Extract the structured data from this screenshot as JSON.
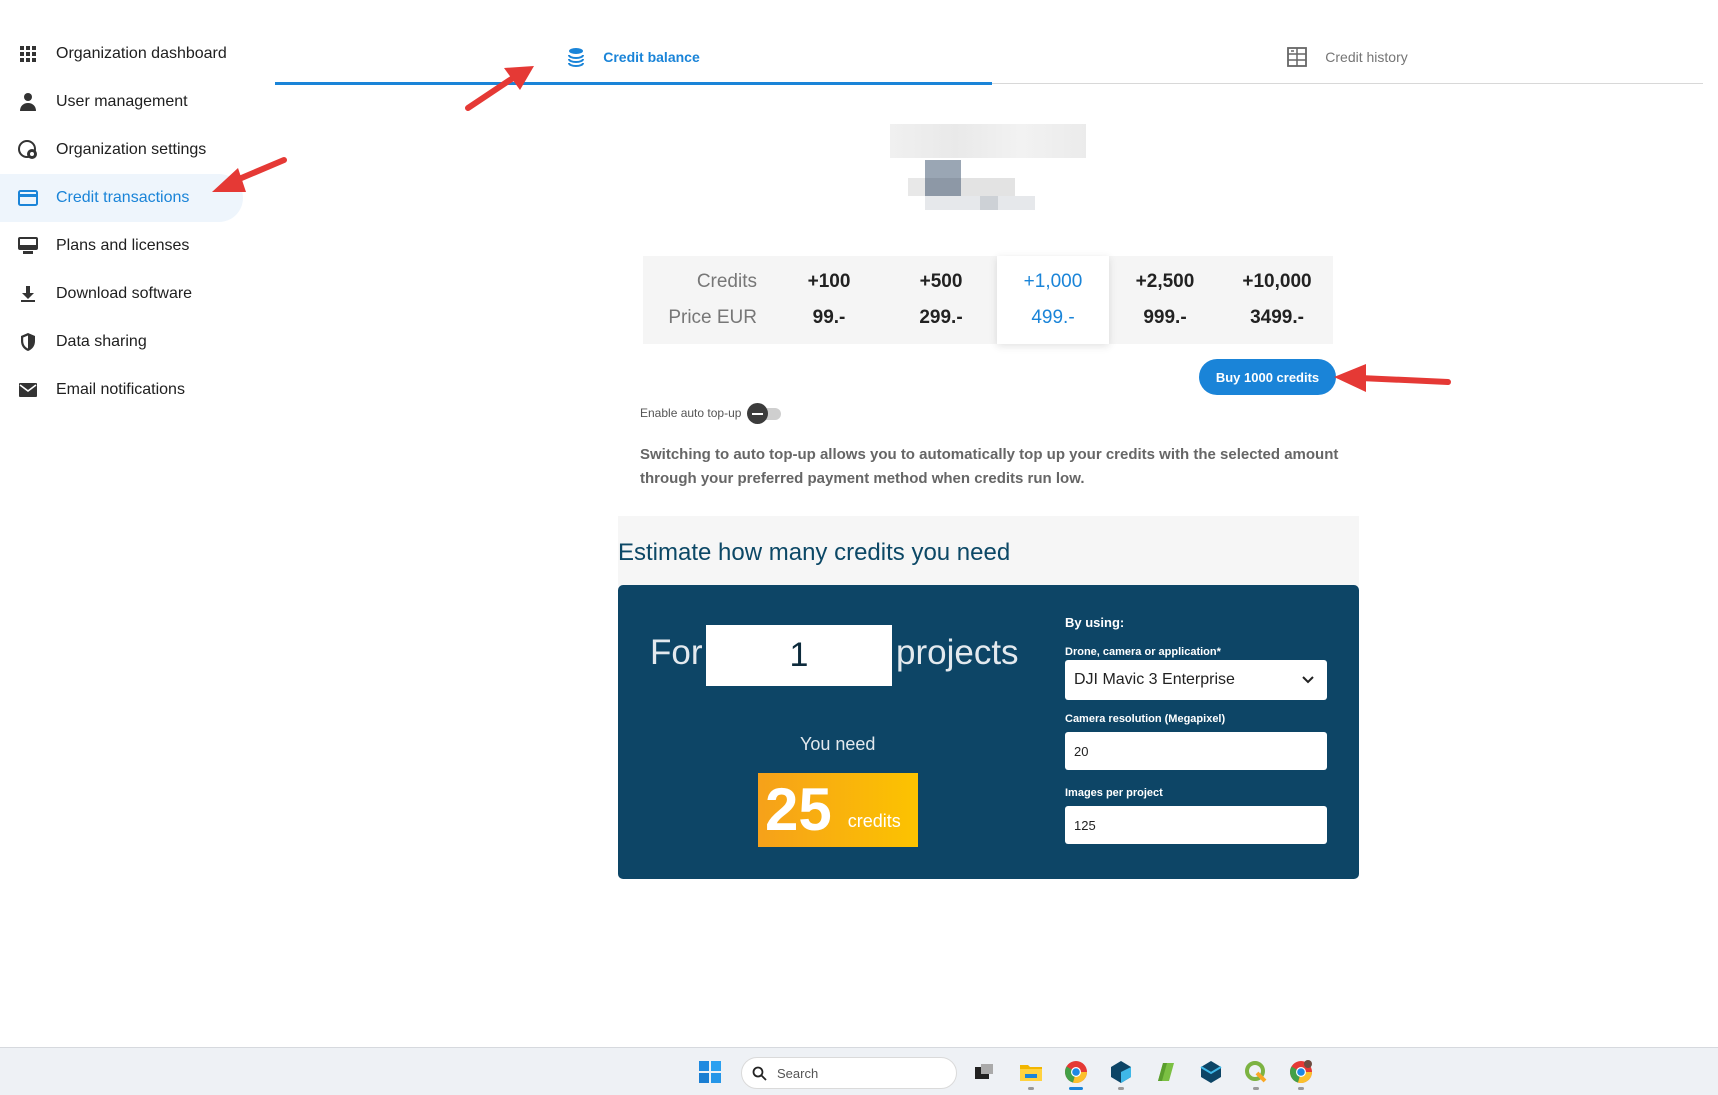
{
  "sidebar": {
    "items": [
      {
        "label": "Organization dashboard",
        "icon": "grid-icon"
      },
      {
        "label": "User management",
        "icon": "user-icon"
      },
      {
        "label": "Organization settings",
        "icon": "org-gear-icon"
      },
      {
        "label": "Credit transactions",
        "icon": "credit-card-icon",
        "active": true
      },
      {
        "label": "Plans and licenses",
        "icon": "monitor-icon"
      },
      {
        "label": "Download software",
        "icon": "download-icon"
      },
      {
        "label": "Data sharing",
        "icon": "shield-icon"
      },
      {
        "label": "Email notifications",
        "icon": "mail-icon"
      }
    ]
  },
  "tabs": {
    "balance": {
      "label": "Credit balance",
      "icon": "coins-stack-icon"
    },
    "history": {
      "label": "Credit history",
      "icon": "table-icon"
    }
  },
  "pricing": {
    "credits_label": "Credits",
    "price_label": "Price EUR",
    "options": [
      {
        "credits": "+100",
        "price": "99.-"
      },
      {
        "credits": "+500",
        "price": "299.-"
      },
      {
        "credits": "+1,000",
        "price": "499.-",
        "selected": true
      },
      {
        "credits": "+2,500",
        "price": "999.-"
      },
      {
        "credits": "+10,000",
        "price": "3499.-"
      }
    ],
    "buy_label": "Buy 1000 credits"
  },
  "auto_topup": {
    "label": "Enable auto top-up",
    "enabled": false,
    "description": "Switching to auto top-up allows you to automatically top up your credits with the selected amount through your preferred payment method when credits run low."
  },
  "estimator": {
    "title": "Estimate how many credits you need",
    "for_label": "For",
    "projects_value": "1",
    "projects_label": "projects",
    "you_need_label": "You need",
    "credits_value": "25",
    "credits_unit": "credits",
    "by_using_label": "By using:",
    "device_label": "Drone, camera or application*",
    "device_value": "DJI Mavic 3 Enterprise",
    "resolution_label": "Camera resolution (Megapixel)",
    "resolution_value": "20",
    "images_label": "Images per project",
    "images_value": "125"
  },
  "taskbar": {
    "search_placeholder": "Search"
  },
  "colors": {
    "accent": "#1a84d8",
    "panel": "#0d4566",
    "credit_box": "#f6a11a",
    "annotation_arrow": "#e53935"
  }
}
